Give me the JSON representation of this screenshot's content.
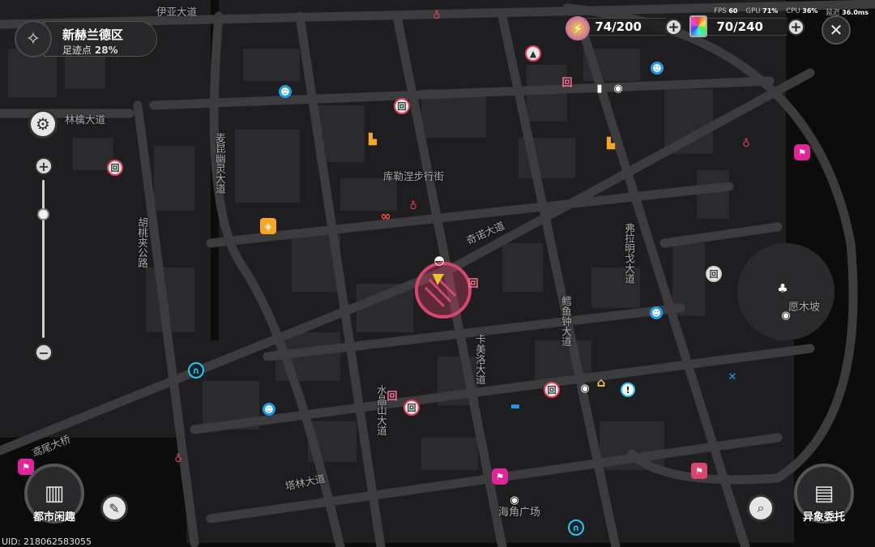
{
  "district": {
    "name": "新赫兰德区",
    "progress_label": "足迹点",
    "progress": "28%"
  },
  "resources": [
    {
      "icon": "energy-bolt-icon",
      "value": "74/200"
    },
    {
      "icon": "card-icon",
      "value": "70/240"
    }
  ],
  "perf": {
    "fps_label": "FPS",
    "fps": "60",
    "gpu_label": "GPU",
    "gpu": "71%",
    "cpu_label": "CPU",
    "cpu": "36%",
    "latency_label": "延迟",
    "latency": "36.0ms"
  },
  "zoom_slider": {
    "level": 0.21
  },
  "streets": [
    "伊亚大道",
    "林檎大道",
    "麦昆幽灵大道",
    "胡桃夹公路",
    "库勒涅步行街",
    "奇诺大道",
    "弗拉明戈大道",
    "鳕鱼钟大道",
    "卡美洛大道",
    "水晶山大道",
    "鸢尾大桥",
    "塔林大道",
    "愿木坡",
    "海角广场"
  ],
  "buttons": {
    "city_fun": "都市闲趣",
    "commission": "异象委托",
    "close": "✕",
    "zoom_in": "+",
    "zoom_out": "−",
    "plus": "+"
  },
  "uid": "UID: 218062583055",
  "markers": [
    {
      "icon": "shop-icon",
      "glyph": "回",
      "color": "#e0405a"
    },
    {
      "icon": "train-station-icon",
      "glyph": "♁",
      "color": "#e0405a"
    },
    {
      "icon": "blue-npc-icon",
      "glyph": "☻",
      "color": "#1e9be8"
    },
    {
      "icon": "orange-building-icon",
      "glyph": "▙",
      "color": "#f5a623"
    },
    {
      "icon": "chain-link-icon",
      "glyph": "∞",
      "color": "#ff4a2a"
    },
    {
      "icon": "hexagon-box-icon",
      "glyph": "◈",
      "color": "#f5a623"
    },
    {
      "icon": "checkered-flag-icon",
      "glyph": "⚑",
      "color": "#e0249a"
    },
    {
      "icon": "portal-icon",
      "glyph": "∩",
      "color": "#2ac8e8"
    },
    {
      "icon": "camera-icon",
      "glyph": "◉",
      "color": "#ffffff"
    },
    {
      "icon": "tree-icon",
      "glyph": "♣",
      "color": "#ffffff"
    },
    {
      "icon": "car-icon",
      "glyph": "▬",
      "color": "#1e9be8"
    },
    {
      "icon": "repair-icon",
      "glyph": "✕",
      "color": "#1e9be8"
    },
    {
      "icon": "museum-icon",
      "glyph": "⌂",
      "color": "#f0d040"
    },
    {
      "icon": "quest-exclaim-icon",
      "glyph": "!",
      "color": "#2ac8e8"
    },
    {
      "icon": "rocket-icon",
      "glyph": "▲",
      "color": "#e0405a"
    },
    {
      "icon": "book-icon",
      "glyph": "▮",
      "color": "#ffffff"
    },
    {
      "icon": "player-car-icon",
      "glyph": "◓",
      "color": "#ffffff"
    }
  ],
  "colors": {
    "player_zone": "#d8456e",
    "road": "#3b3a3d",
    "block": "#1d1c1f",
    "building": "#2c2b2e"
  }
}
